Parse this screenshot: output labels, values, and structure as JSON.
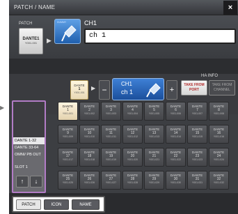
{
  "window": {
    "title": "PATCH / NAME",
    "close": "×"
  },
  "header": {
    "patch_label": "PATCH",
    "patch_tile": {
      "name": "DANTE1",
      "port": "Y001-001"
    },
    "icon_label": "DUMMY",
    "channel_label": "CH1",
    "channel_name": "ch 1"
  },
  "selector": {
    "current": {
      "name": "DANTE",
      "channel": "1",
      "port": "Y001-001"
    },
    "minus": "−",
    "plus": "+",
    "display": {
      "channel": "CH1",
      "name": "ch 1"
    }
  },
  "ha_info": {
    "title": "HA INFO",
    "take_from_port": "TAKE FROM PORT",
    "take_from_channel": "TAKE FROM CHANNEL"
  },
  "sidebar": {
    "items": [
      {
        "label": "DANTE 1-32",
        "active": true
      },
      {
        "label": "DANTE 33-64",
        "active": false
      },
      {
        "label": "OMNI/ PB OUT",
        "active": false
      },
      {
        "label": "SLOT 1",
        "active": false
      }
    ],
    "up": "↑",
    "down": "↓"
  },
  "grid": {
    "tiles": [
      {
        "n": "DANTE",
        "c": "1",
        "p": "Y001-001",
        "active": true
      },
      {
        "n": "DANTE",
        "c": "2",
        "p": "Y001-002"
      },
      {
        "n": "DANTE",
        "c": "3",
        "p": "Y001-003"
      },
      {
        "n": "DANTE",
        "c": "4",
        "p": "Y001-004"
      },
      {
        "n": "DANTE",
        "c": "5",
        "p": "Y001-005"
      },
      {
        "n": "DANTE",
        "c": "6",
        "p": "Y001-006"
      },
      {
        "n": "DANTE",
        "c": "7",
        "p": "Y001-007"
      },
      {
        "n": "DANTE",
        "c": "8",
        "p": "Y001-008"
      },
      {
        "n": "DANTE",
        "c": "9",
        "p": "Y001-009"
      },
      {
        "n": "DANTE",
        "c": "10",
        "p": "Y001-010"
      },
      {
        "n": "DANTE",
        "c": "11",
        "p": "Y001-011"
      },
      {
        "n": "DANTE",
        "c": "12",
        "p": "Y001-012"
      },
      {
        "n": "DANTE",
        "c": "13",
        "p": "Y001-013"
      },
      {
        "n": "DANTE",
        "c": "14",
        "p": "Y001-014"
      },
      {
        "n": "DANTE",
        "c": "15",
        "p": "Y001-015"
      },
      {
        "n": "DANTE",
        "c": "16",
        "p": "Y001-016"
      },
      {
        "n": "DANTE",
        "c": "17",
        "p": "Y001-017"
      },
      {
        "n": "DANTE",
        "c": "18",
        "p": "Y001-018"
      },
      {
        "n": "DANTE",
        "c": "19",
        "p": "Y001-019"
      },
      {
        "n": "DANTE",
        "c": "20",
        "p": "Y001-020"
      },
      {
        "n": "DANTE",
        "c": "21",
        "p": "Y001-021"
      },
      {
        "n": "DANTE",
        "c": "22",
        "p": "Y001-022"
      },
      {
        "n": "DANTE",
        "c": "23",
        "p": "Y001-023"
      },
      {
        "n": "DANTE",
        "c": "24",
        "p": "Y001-024"
      },
      {
        "n": "DANTE",
        "c": "25",
        "p": "Y001-025"
      },
      {
        "n": "DANTE",
        "c": "26",
        "p": "Y001-026"
      },
      {
        "n": "DANTE",
        "c": "27",
        "p": "Y001-027"
      },
      {
        "n": "DANTE",
        "c": "28",
        "p": "Y001-028"
      },
      {
        "n": "DANTE",
        "c": "29",
        "p": "Y001-029"
      },
      {
        "n": "DANTE",
        "c": "30",
        "p": "Y001-030"
      },
      {
        "n": "DANTE",
        "c": "31",
        "p": "Y001-031"
      },
      {
        "n": "DANTE",
        "c": "32",
        "p": "Y001-032"
      }
    ]
  },
  "tabs": [
    {
      "label": "PATCH",
      "active": true
    },
    {
      "label": "ICON",
      "active": false
    },
    {
      "label": "NAME",
      "active": false
    }
  ],
  "colors": {
    "accent": "#b27cc6",
    "highlight": "#b12a2a",
    "selected_tile": "#fff5e0"
  },
  "icons": {
    "pointer": "triangle-right-icon",
    "channel_icon": "microphone-icon"
  }
}
